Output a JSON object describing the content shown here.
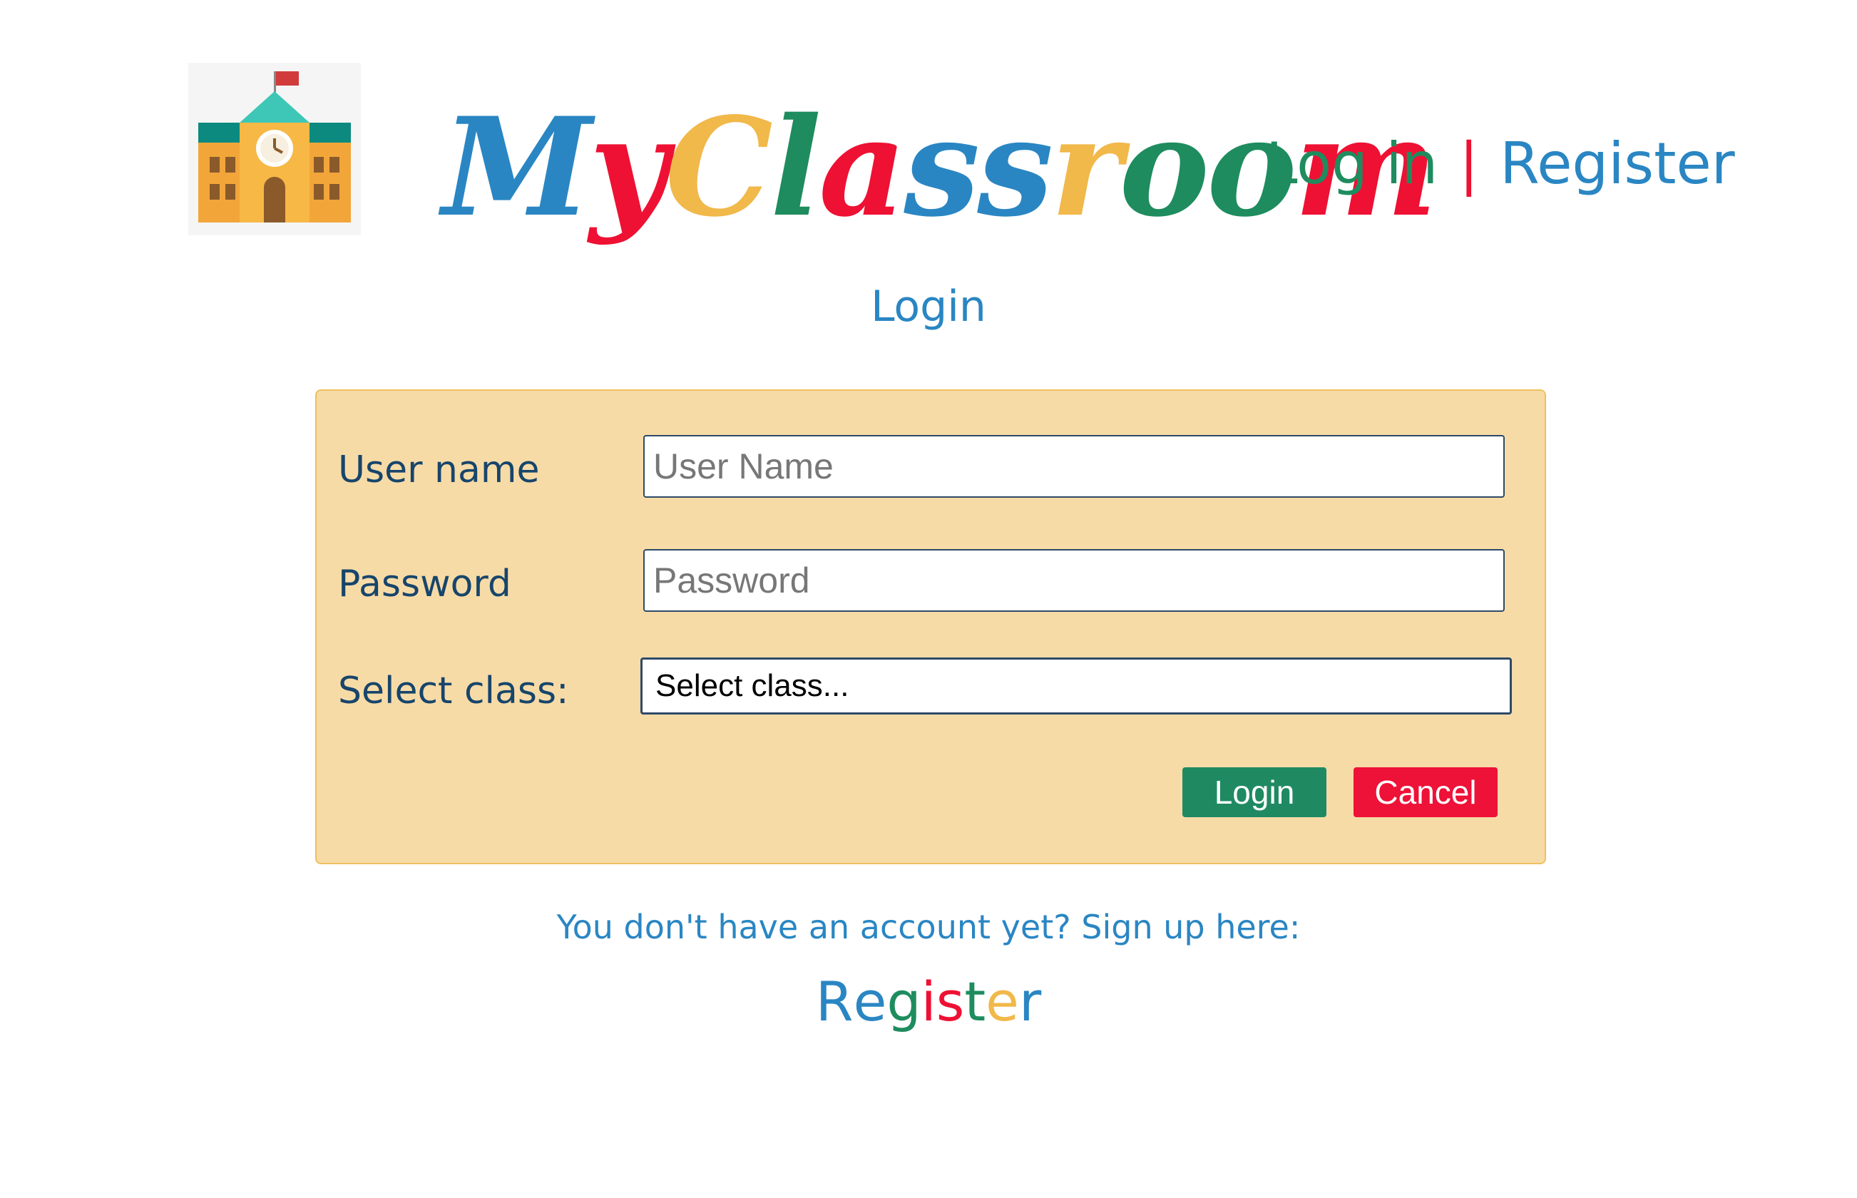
{
  "header": {
    "brand_letters": [
      {
        "ch": "M",
        "color": "#2a86c3"
      },
      {
        "ch": "y",
        "color": "#ee1133"
      },
      {
        "ch": "C",
        "color": "#f1b84a"
      },
      {
        "ch": "l",
        "color": "#1e8c5e"
      },
      {
        "ch": "a",
        "color": "#ee1133"
      },
      {
        "ch": "s",
        "color": "#2a86c3"
      },
      {
        "ch": "s",
        "color": "#2a86c3"
      },
      {
        "ch": "r",
        "color": "#f1b84a"
      },
      {
        "ch": "o",
        "color": "#1e8c5e"
      },
      {
        "ch": "o",
        "color": "#1e8c5e"
      },
      {
        "ch": "m",
        "color": "#ee1133"
      }
    ],
    "nav": {
      "login": "Log in",
      "separator": "|",
      "register": "Register"
    }
  },
  "page": {
    "title": "Login"
  },
  "form": {
    "username": {
      "label": "User name",
      "placeholder": "User Name",
      "value": ""
    },
    "password": {
      "label": "Password",
      "placeholder": "Password",
      "value": ""
    },
    "class_select": {
      "label": "Select class:",
      "selected": "Select class..."
    },
    "login_button": "Login",
    "cancel_button": "Cancel"
  },
  "footer": {
    "hint": "You don't have an account yet? Sign up here:",
    "register_letters": [
      {
        "ch": "R",
        "color": "#2a86c3"
      },
      {
        "ch": "e",
        "color": "#2a86c3"
      },
      {
        "ch": "g",
        "color": "#1e8c5e"
      },
      {
        "ch": "i",
        "color": "#ee1133"
      },
      {
        "ch": "s",
        "color": "#ee1133"
      },
      {
        "ch": "t",
        "color": "#1e8c5e"
      },
      {
        "ch": "e",
        "color": "#f1b84a"
      },
      {
        "ch": "r",
        "color": "#2a86c3"
      }
    ]
  },
  "colors": {
    "blue": "#2a86c3",
    "red": "#ee1133",
    "yellow": "#f1b84a",
    "green": "#1e8c5e",
    "panel_bg": "#f7dba7",
    "label_text": "#17456b"
  },
  "icons": {
    "logo": "school-building-icon"
  }
}
